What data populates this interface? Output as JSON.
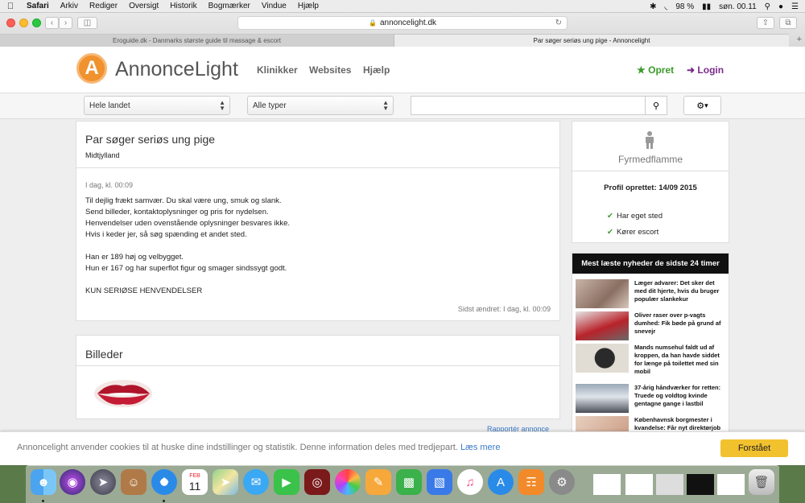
{
  "menubar": {
    "apple": "",
    "app": "Safari",
    "items": [
      "Arkiv",
      "Rediger",
      "Oversigt",
      "Historik",
      "Bogmærker",
      "Vindue",
      "Hjælp"
    ],
    "battery": "98 %",
    "clock": "søn. 00.11"
  },
  "browser": {
    "url": "annoncelight.dk",
    "tabs": [
      {
        "label": "Eroguide.dk - Danmarks største guide til massage & escort",
        "active": false
      },
      {
        "label": "Par søger seriøs ung pige - Annoncelight",
        "active": true
      }
    ],
    "new_tab": "+"
  },
  "header": {
    "logo_letter": "A",
    "logo_text": "AnnonceLight",
    "nav": [
      "Klinikker",
      "Websites",
      "Hjælp"
    ],
    "opret": "Opret",
    "login": "Login"
  },
  "search": {
    "region_select": "Hele landet",
    "type_select": "Alle typer",
    "query": ""
  },
  "ad": {
    "title": "Par søger seriøs ung pige",
    "region": "Midtjylland",
    "time": "I dag, kl. 00:09",
    "body": [
      "Til dejlig frækt samvær. Du skal være ung, smuk og slank.",
      "Send billeder, kontaktoplysninger og pris for nydelsen.",
      "Henvendelser uden ovenstående oplysninger besvares ikke.",
      "Hvis i keder jer, så søg spænding et andet sted.",
      "",
      "Han er 189 høj og velbygget.",
      "Hun er 167 og har superflot figur og smager sindssygt godt.",
      "",
      "KUN SERIØSE HENVENDELSER"
    ],
    "changed": "Sidst ændret: I dag, kl. 00:09"
  },
  "images": {
    "title": "Billeder"
  },
  "report": "Rapportér annonce",
  "profile": {
    "name": "Fyrmedflamme",
    "created": "Profil oprettet: 14/09 2015",
    "features": [
      "Har eget sted",
      "Kører escort"
    ]
  },
  "news": {
    "heading": "Mest læste nyheder de sidste 24 timer",
    "items": [
      "Læger advarer: Det sker det med dit hjerte, hvis du bruger populær slankekur",
      "Oliver raser over p-vagts dumhed: Fik bøde på grund af snevejr",
      "Mands numsehul faldt ud af kroppen, da han havde siddet for længe på toilettet med sin mobil",
      "37-årig håndværker for retten: Truede og voldtog kvinde gentagne gange i lastbil",
      "Københavnsk borgmester i kvandelse: Får nyt direktørjob"
    ]
  },
  "cookie": {
    "text": "Annoncelight anvender cookies til at huske dine indstillinger og statistik. Denne information deles med tredjepart.",
    "link": "Læs mere",
    "button": "Forstået"
  },
  "dock": {
    "apps": [
      "Finder",
      "Siri",
      "Launchpad",
      "Contacts",
      "Safari",
      "Calendar",
      "Maps",
      "Messages",
      "FaceTime",
      "Photo Booth",
      "Photos",
      "Pages",
      "Numbers",
      "Keynote",
      "iTunes",
      "App Store",
      "iBooks",
      "System Preferences"
    ],
    "calendar_month": "FEB",
    "calendar_day": "11"
  }
}
